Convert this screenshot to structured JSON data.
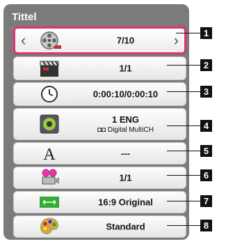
{
  "title": "Tittel",
  "rows": [
    {
      "value": "7/10",
      "icon": "film-reel-icon",
      "badge": "1"
    },
    {
      "value": "1/1",
      "icon": "clapperboard-icon",
      "badge": "2"
    },
    {
      "value": "0:00:10/0:00:10",
      "icon": "clock-icon",
      "badge": "3"
    },
    {
      "value": "1 ENG",
      "sub": "◘◘ Digital   MultiCH",
      "icon": "speaker-icon",
      "badge": "4"
    },
    {
      "value": "---",
      "icon": "subtitle-letter-icon",
      "badge": "5"
    },
    {
      "value": "1/1",
      "icon": "camera-angle-icon",
      "badge": "6"
    },
    {
      "value": "16:9 Original",
      "icon": "aspect-ratio-icon",
      "badge": "7"
    },
    {
      "value": "Standard",
      "icon": "palette-icon",
      "badge": "8"
    }
  ],
  "colors": {
    "selected_border": "#e0307c",
    "panel": "#7b7b7b"
  }
}
